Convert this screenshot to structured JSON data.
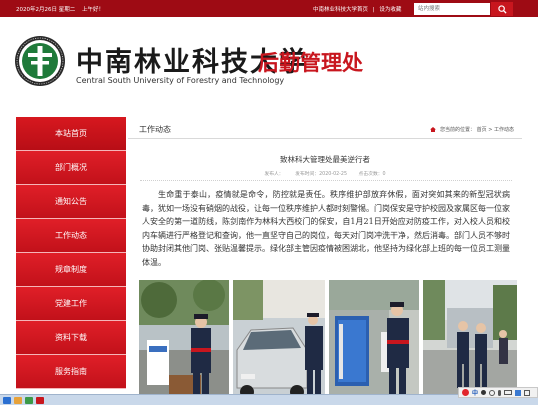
{
  "topbar": {
    "date": "2020年2月26日 星期二",
    "greeting": "上午好！",
    "link_home": "中南林业科技大学首页",
    "link_bookmark": "设为收藏",
    "search_placeholder": "站内搜索"
  },
  "header": {
    "school_cn": "中南林业科技大学",
    "school_en": "Central South University of Forestry and Technology",
    "department": "后勤管理处"
  },
  "sidebar": {
    "items": [
      {
        "label": "本站首页"
      },
      {
        "label": "部门概况"
      },
      {
        "label": "通知公告"
      },
      {
        "label": "工作动态"
      },
      {
        "label": "规章制度"
      },
      {
        "label": "党建工作"
      },
      {
        "label": "资料下载"
      },
      {
        "label": "服务指南"
      }
    ]
  },
  "section": {
    "title": "工作动态",
    "breadcrumb_prefix": "您当前的位置：",
    "breadcrumb_home": "首页",
    "breadcrumb_sep": " > ",
    "breadcrumb_current": "工作动态"
  },
  "article": {
    "title": "致林科大管理处最美逆行者",
    "author": "发布人：",
    "date": "发布时间：2020-02-25",
    "views": "点击次数：0",
    "body": "生命重于泰山，疫情就是命令，防控就是责任。秩序维护部放弃休假，面对突如其来的新型冠状病毒，犹如一场没有硝烟的战役，让每一位秩序维护人都时刻警惕。门岗保安是守护校园及家属区每一位家人安全的第一道防线，陈剑南作为林科大西校门的保安，自1月21日开始应对防疫工作，对入校人员和校内车辆进行严格登记和查询，他一直坚守自己的岗位，每天对门岗冲洗干净，然后消毒。部门人员不够时协助封闭其他门岗、张贴温馨提示。绿化部主管因疫情被困湖北，他坚持为绿化部上班的每一位员工测量体温。"
  },
  "tray": {
    "ime_label": "中"
  },
  "colors": {
    "brand_red": "#c8161e",
    "topbar_red": "#9e0b14",
    "nav_red": "#e01f28"
  }
}
